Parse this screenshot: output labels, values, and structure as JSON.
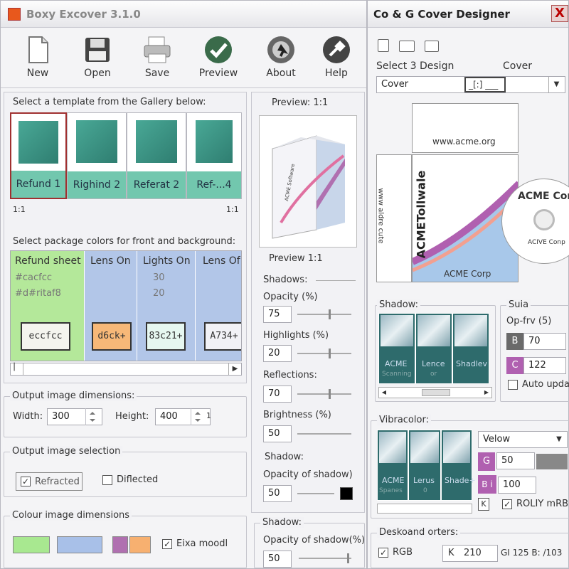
{
  "left_window": {
    "title": "Boxy Excover 3.1.0",
    "toolbar": [
      {
        "label": "New",
        "icon": "new-document-icon"
      },
      {
        "label": "Open",
        "icon": "open-floppy-icon"
      },
      {
        "label": "Save",
        "icon": "save-printer-icon"
      },
      {
        "label": "Preview",
        "icon": "preview-checkmark-icon"
      },
      {
        "label": "About",
        "icon": "about-cursor-icon"
      },
      {
        "label": "Help",
        "icon": "help-wrench-icon"
      }
    ],
    "gallery": {
      "heading": "Select a template from the Gallery below:",
      "items": [
        "Refund 1",
        "Righind 2",
        "Referat 2",
        "Ref-...4"
      ],
      "scale_left": "1:1",
      "scale_right": "1:1"
    },
    "colors": {
      "heading": "Select package colors for front and background:",
      "columns": [
        {
          "title": "Refund sheet",
          "line1": "#cacfcc",
          "line2": "#d#ritaf8",
          "chip": "eccfcc",
          "bg": "#b4e89a",
          "chip_bg": "#f4f4ee"
        },
        {
          "title": "Lens On",
          "line1": "",
          "line2": "",
          "chip": "d6ck+",
          "bg": "#b2c6e8",
          "chip_bg": "#f7b878"
        },
        {
          "title": "Lights On",
          "line1": "30",
          "line2": "20",
          "chip": "83c21+",
          "bg": "#b2c6e8",
          "chip_bg": "#e6f7f0"
        },
        {
          "title": "Lens Of",
          "line1": "",
          "line2": "",
          "chip": "A734+",
          "bg": "#b2c6e8",
          "chip_bg": "#f2f2f6"
        }
      ]
    },
    "output_dimensions": {
      "label": "Output image dimensions:",
      "width_label": "Width:",
      "width_value": "300",
      "height_label": "Height:",
      "height_value": "400",
      "height_suffix": "1"
    },
    "output_selection": {
      "label": "Output image selection",
      "option1": "Refracted",
      "option1_checked": "✓",
      "option2": "Diflected",
      "option2_checked": ""
    },
    "colour_dimensions": {
      "label": "Colour image dimensions",
      "swatches": [
        "#a8e890",
        "#a8c0e8",
        "#b070b0",
        "#f7b070"
      ],
      "check_label": "Eixa moodl",
      "check_mark": "✓"
    },
    "preview": {
      "title": "Preview: 1:1",
      "caption": "Preview 1:1",
      "box_text": "ACME Software",
      "shadows_label": "Shadows:",
      "opacity_label": "Opacity (%)",
      "opacity_value": "75",
      "highlights_label": "Highlights (%)",
      "highlights_value": "20",
      "reflections_label": "Reflections:",
      "reflections_value": "70",
      "brightness_label": "Brightness (%)",
      "brightness_value": "50",
      "shadow_label": "Shadow:",
      "shadow_opacity_label": "Opacity of shadow)",
      "shadow_opacity_value": "50",
      "shadow2_label": "Shadow:",
      "shadow2_opacity_label": "Opacity of shadow(%)",
      "shadow2_opacity_value": "50"
    }
  },
  "right_window": {
    "title": "Co & G Cover Designer",
    "close": "X",
    "select_label": "Select 3 Design",
    "cover_label": "Cover",
    "cover_value": "Cover",
    "cover_mid": "_[:] ___",
    "spine_text": "www.acme.org",
    "spine_vertical": "www aldre cute",
    "front_text": "ACMETollwale",
    "front_footer": "ACME Corp",
    "cd_title": "ACME Corp",
    "cd_footer": "ACIVE Conp",
    "shadow_group": {
      "label": "Shadow:",
      "thumbs": [
        {
          "line1": "ACME",
          "line2": "Scanning"
        },
        {
          "line1": "Lence",
          "line2": "or"
        },
        {
          "line1": "Shadlev",
          "line2": ""
        }
      ]
    },
    "suia_group": {
      "label": "Suia",
      "opfrv_label": "Op-frv (5)",
      "b_label": "B",
      "b_value": "70",
      "c_label": "C",
      "c_value": "122",
      "auto_label": "Auto updal"
    },
    "vibra_group": {
      "label": "Vibracolor:",
      "thumbs": [
        {
          "line1": "ACME",
          "line2": "Spanes"
        },
        {
          "line1": "Lerus",
          "line2": "0"
        },
        {
          "line1": "Shade+",
          "line2": ""
        }
      ],
      "select_value": "Velow",
      "g_label": "G",
      "g_value": "50",
      "bi_label": "B i",
      "bi_value": "100",
      "k_label": "K",
      "roliy_label": "ROLIY mRB",
      "roliy_mark": "✓"
    },
    "deskoand": {
      "label": "Deskoand orters:",
      "rgb_label": "RGB",
      "rgb_mark": "✓",
      "k_label": "K",
      "k_value": "210",
      "info": "GI 125 B: /103"
    }
  }
}
